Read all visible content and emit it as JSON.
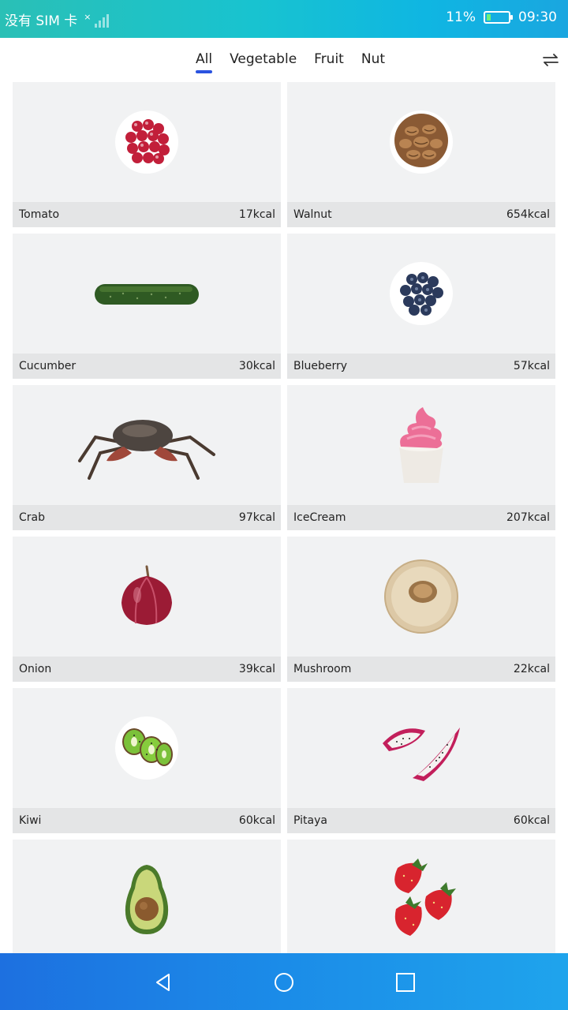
{
  "status_bar": {
    "carrier": "没有 SIM 卡",
    "battery_percent": "11%",
    "battery_level": 0.11,
    "time": "09:30"
  },
  "tabs": [
    {
      "label": "All",
      "active": true
    },
    {
      "label": "Vegetable",
      "active": false
    },
    {
      "label": "Fruit",
      "active": false
    },
    {
      "label": "Nut",
      "active": false
    }
  ],
  "foods": [
    {
      "name": "Tomato",
      "kcal": "17kcal",
      "icon": "tomato-icon"
    },
    {
      "name": "Walnut",
      "kcal": "654kcal",
      "icon": "walnut-icon"
    },
    {
      "name": "Cucumber",
      "kcal": "30kcal",
      "icon": "cucumber-icon"
    },
    {
      "name": "Blueberry",
      "kcal": "57kcal",
      "icon": "blueberry-icon"
    },
    {
      "name": "Crab",
      "kcal": "97kcal",
      "icon": "crab-icon"
    },
    {
      "name": "IceCream",
      "kcal": "207kcal",
      "icon": "icecream-icon"
    },
    {
      "name": "Onion",
      "kcal": "39kcal",
      "icon": "onion-icon"
    },
    {
      "name": "Mushroom",
      "kcal": "22kcal",
      "icon": "mushroom-icon"
    },
    {
      "name": "Kiwi",
      "kcal": "60kcal",
      "icon": "kiwi-icon"
    },
    {
      "name": "Pitaya",
      "kcal": "60kcal",
      "icon": "pitaya-icon"
    },
    {
      "name": "",
      "kcal": "",
      "icon": "avocado-icon"
    },
    {
      "name": "",
      "kcal": "",
      "icon": "strawberry-icon"
    }
  ],
  "colors": {
    "active_tab_indicator": "#2a53e0",
    "card_background": "#f1f2f3",
    "card_label_bar": "#e4e5e6"
  }
}
